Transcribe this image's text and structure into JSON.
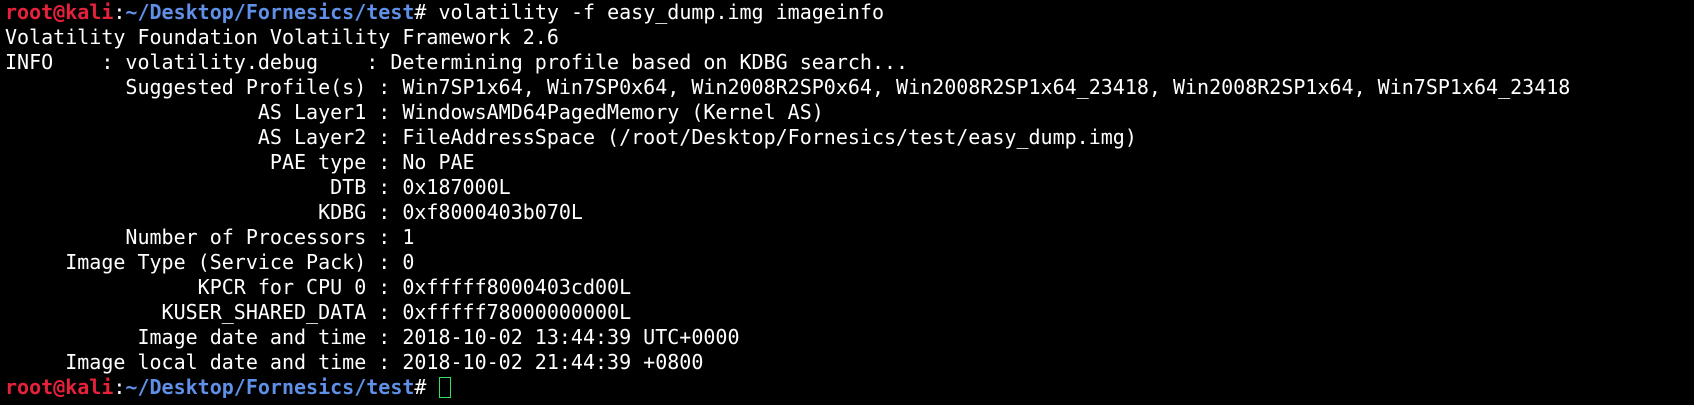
{
  "prompt": {
    "user": "root@kali",
    "separator": ":",
    "path": "~/Desktop/Fornesics/test",
    "symbol": "#"
  },
  "command": " volatility -f easy_dump.img imageinfo",
  "output": [
    "Volatility Foundation Volatility Framework 2.6",
    "INFO    : volatility.debug    : Determining profile based on KDBG search...",
    "          Suggested Profile(s) : Win7SP1x64, Win7SP0x64, Win2008R2SP0x64, Win2008R2SP1x64_23418, Win2008R2SP1x64, Win7SP1x64_23418",
    "                     AS Layer1 : WindowsAMD64PagedMemory (Kernel AS)",
    "                     AS Layer2 : FileAddressSpace (/root/Desktop/Fornesics/test/easy_dump.img)",
    "                      PAE type : No PAE",
    "                           DTB : 0x187000L",
    "                          KDBG : 0xf8000403b070L",
    "          Number of Processors : 1",
    "     Image Type (Service Pack) : 0",
    "                KPCR for CPU 0 : 0xfffff8000403cd00L",
    "             KUSER_SHARED_DATA : 0xfffff78000000000L",
    "           Image date and time : 2018-10-02 13:44:39 UTC+0000",
    "     Image local date and time : 2018-10-02 21:44:39 +0800"
  ],
  "colors": {
    "background": "#000000",
    "text": "#ffffff",
    "user": "#e8213b",
    "path": "#5f8fe6",
    "cursor": "#2ee35a"
  }
}
